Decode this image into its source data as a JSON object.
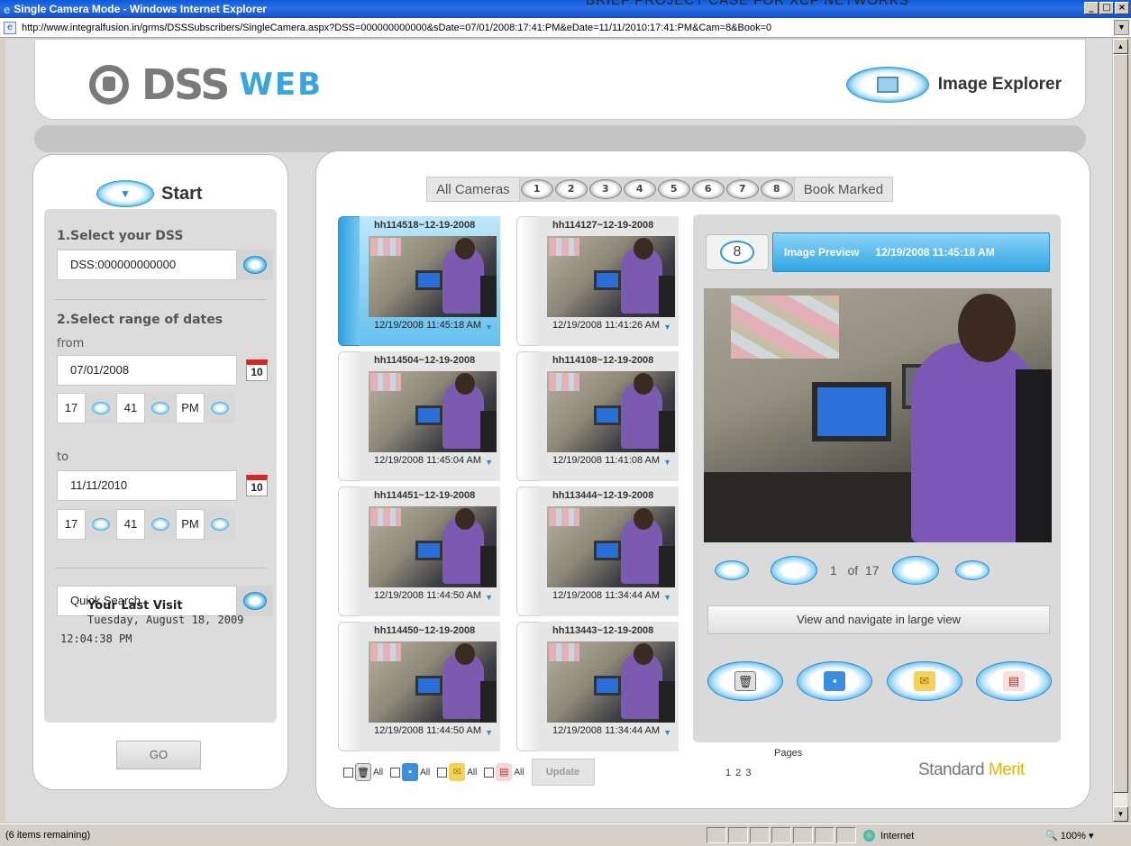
{
  "window": {
    "title": "Single Camera Mode - Windows Internet Explorer",
    "overlay_heading": "BRIEF PROJECT CASE FOR XCF NETWORKS",
    "url": "http://www.integralfusion.in/grms/DSSSubscribers/SingleCamera.aspx?DSS=000000000000&sDate=07/01/2008:17:41:PM&eDate=11/11/2010:17:41:PM&Cam=8&Book=0",
    "status_text": "(6 items remaining)",
    "zone": "Internet",
    "zoom": "100%"
  },
  "header": {
    "logo_main": "DSS",
    "logo_sub": "WEB",
    "explorer_label": "Image Explorer",
    "icons": {
      "explorer": "image-explorer-icon"
    }
  },
  "sidebar": {
    "start_label": "Start",
    "select_dss_label": "1.Select your DSS",
    "dss_value": "DSS:000000000000",
    "date_range_label": "2.Select range of dates",
    "from_label": "from",
    "from_date": "07/01/2008",
    "from_hour": "17",
    "from_minute": "41",
    "from_ampm": "PM",
    "to_label": "to",
    "to_date": "11/11/2010",
    "to_hour": "17",
    "to_minute": "41",
    "to_ampm": "PM",
    "calendar_day": "10",
    "quick_search": "Quick Search",
    "last_visit_title": "Your Last Visit",
    "last_visit_date": "Tuesday, August 18, 2009",
    "last_visit_time": "12:04:38 PM",
    "go_label": "GO"
  },
  "camera_tabs": {
    "all_label": "All Cameras",
    "numbers": [
      "1",
      "2",
      "3",
      "4",
      "5",
      "6",
      "7",
      "8"
    ],
    "bookmarked_label": "Book Marked"
  },
  "thumbnails": [
    {
      "title": "hh114518~12-19-2008",
      "date": "12/19/2008 11:45:18 AM",
      "selected": true
    },
    {
      "title": "hh114127~12-19-2008",
      "date": "12/19/2008 11:41:26 AM",
      "selected": false
    },
    {
      "title": "hh114504~12-19-2008",
      "date": "12/19/2008 11:45:04 AM",
      "selected": false
    },
    {
      "title": "hh114108~12-19-2008",
      "date": "12/19/2008 11:41:08 AM",
      "selected": false
    },
    {
      "title": "hh114451~12-19-2008",
      "date": "12/19/2008 11:44:50 AM",
      "selected": false
    },
    {
      "title": "hh113444~12-19-2008",
      "date": "12/19/2008 11:34:44 AM",
      "selected": false
    },
    {
      "title": "hh114450~12-19-2008",
      "date": "12/19/2008 11:44:50 AM",
      "selected": false
    },
    {
      "title": "hh113443~12-19-2008",
      "date": "12/19/2008 11:34:44 AM",
      "selected": false
    }
  ],
  "bulk_actions": {
    "all_label": "All",
    "update_label": "Update"
  },
  "preview": {
    "camera_number": "8",
    "title": "Image Preview",
    "timestamp": "12/19/2008 11:45:18 AM",
    "current_page": "1",
    "of_label": "of",
    "total_pages": "17",
    "large_view_label": "View and navigate in large view"
  },
  "pager": {
    "label": "Pages",
    "numbers": "1 2 3"
  },
  "brand": {
    "first": "Standard",
    "second": "Merit"
  },
  "colors": {
    "accent": "#2ea6e4",
    "brand_yellow": "#f0b400",
    "titlebar": "#0a5ad8"
  }
}
